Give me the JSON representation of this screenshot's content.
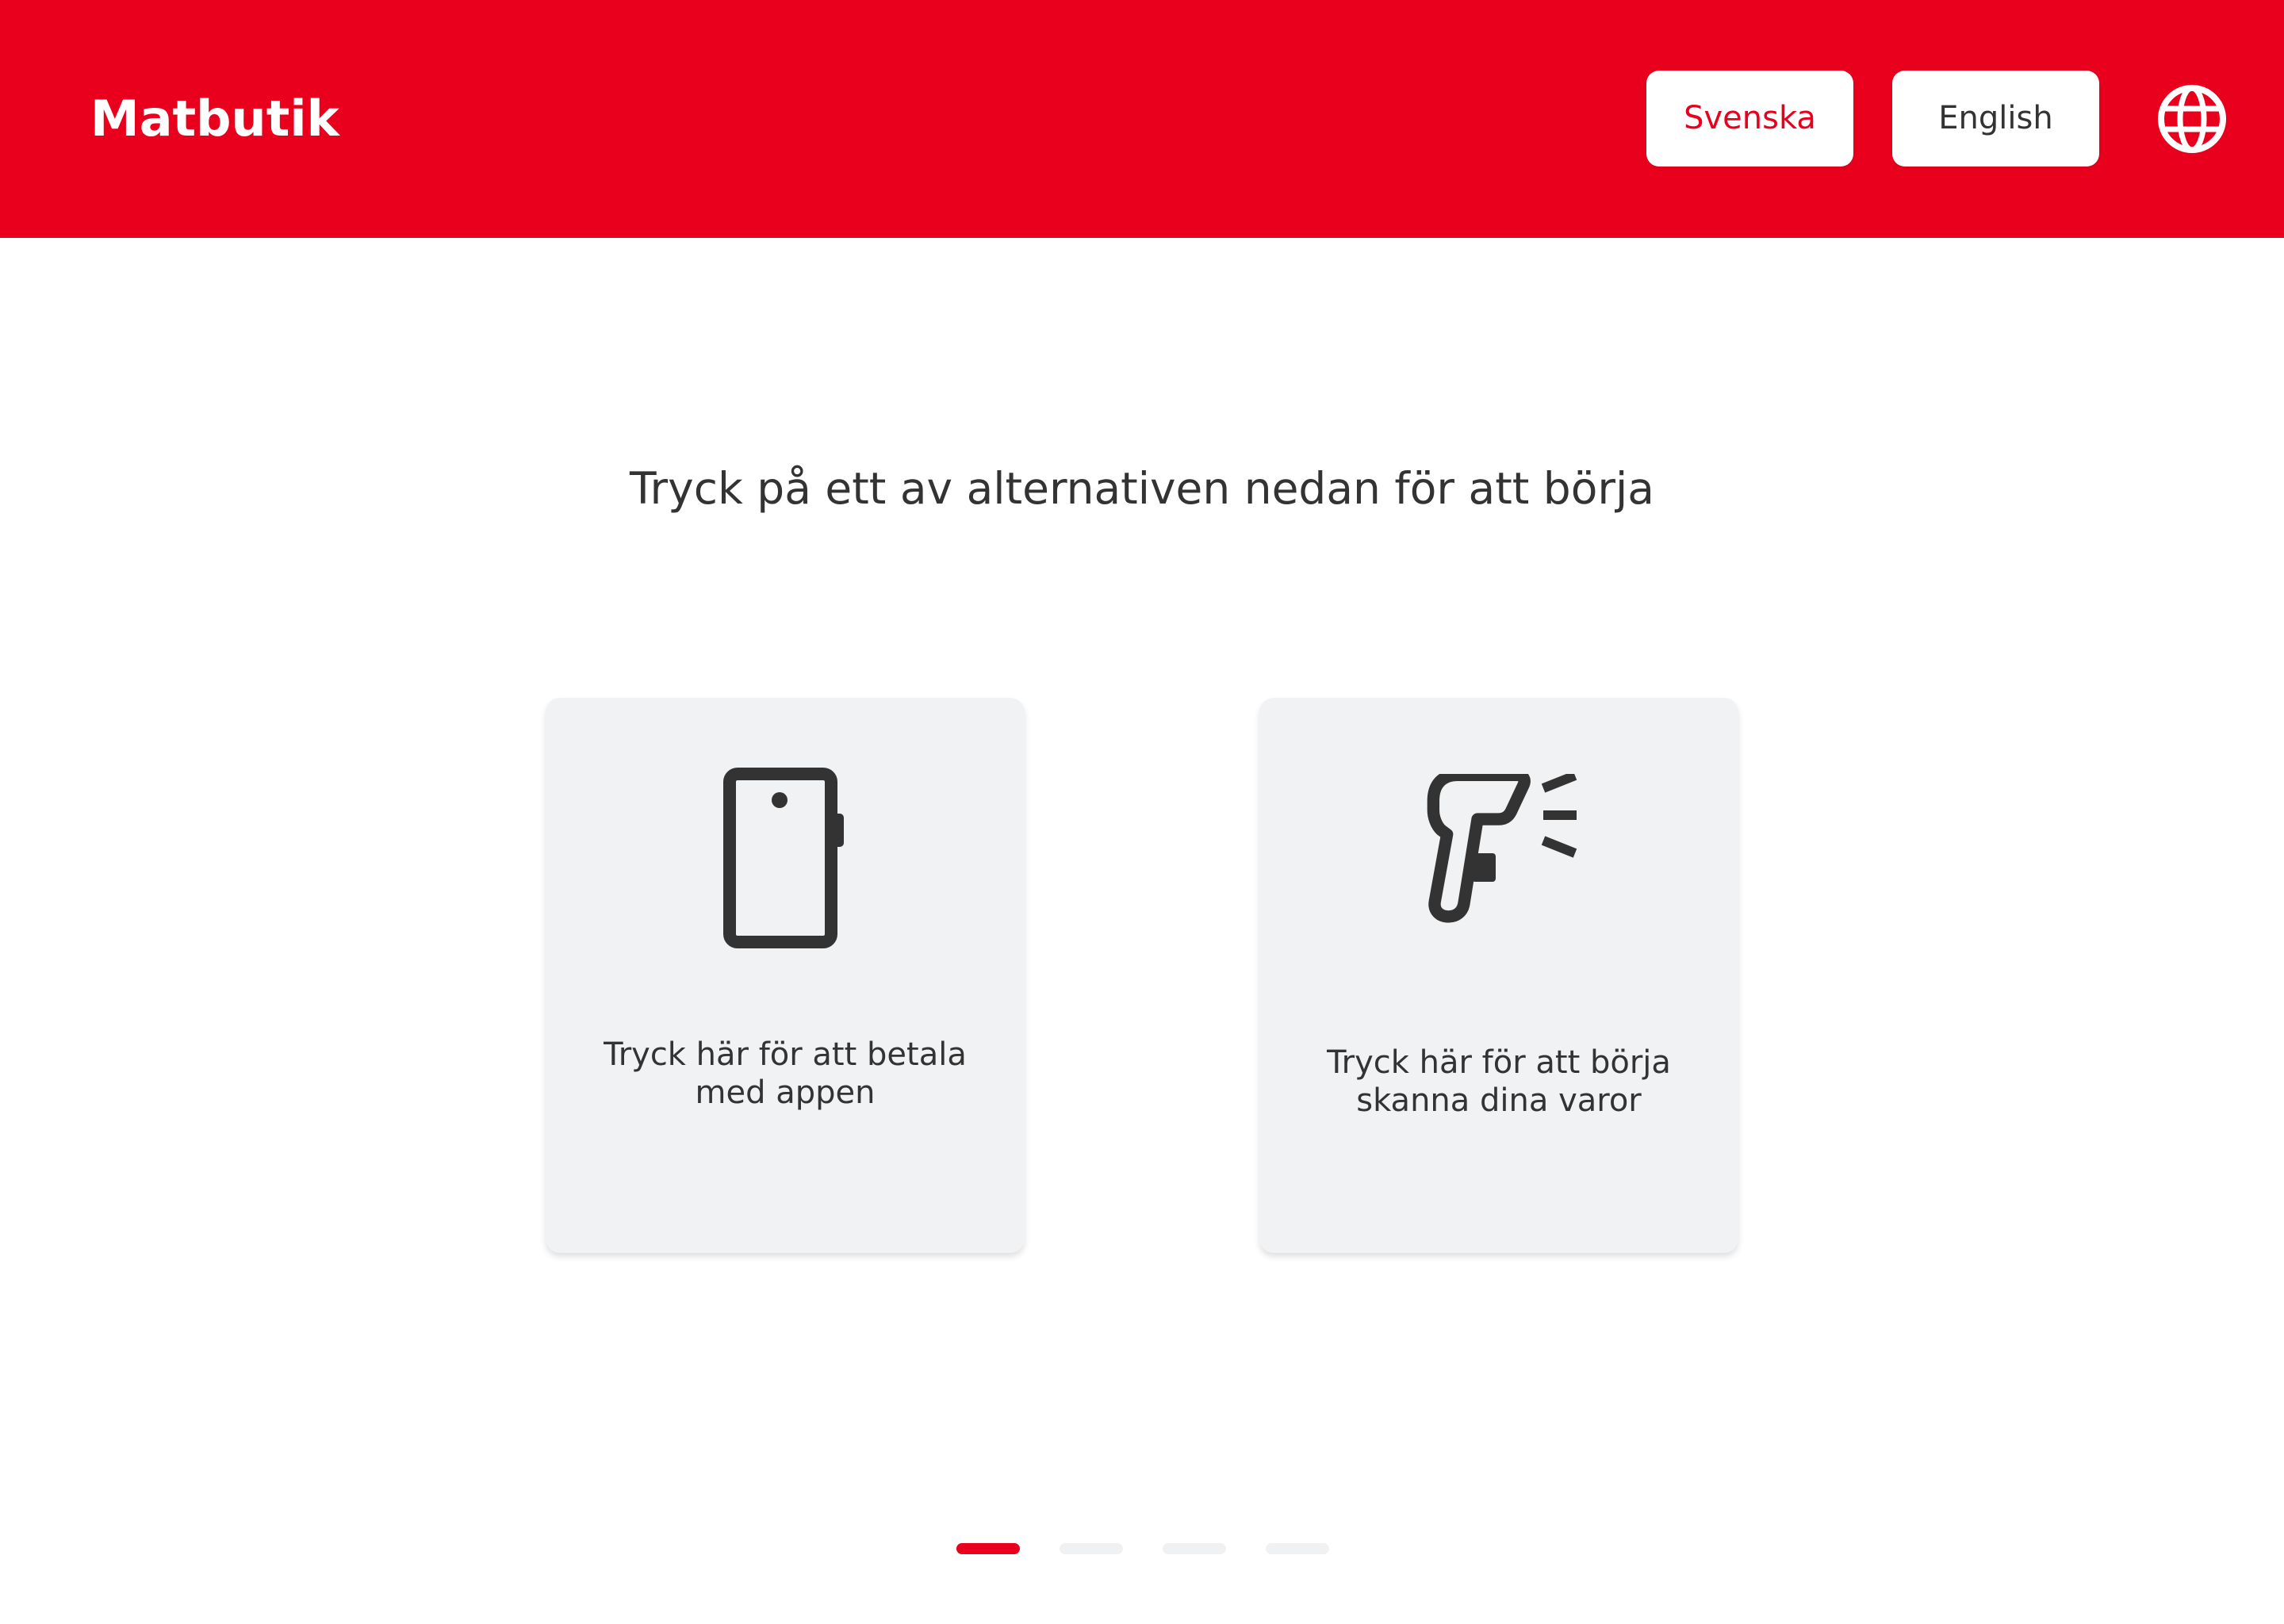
{
  "header": {
    "brand": "Matbutik",
    "languages": [
      {
        "label": "Svenska",
        "selected": true
      },
      {
        "label": "English",
        "selected": false
      }
    ],
    "globe_icon": "globe-icon"
  },
  "main": {
    "prompt": "Tryck på ett av alternativen nedan för att börja",
    "options": [
      {
        "icon": "phone-icon",
        "line1": "Tryck här för att betala",
        "line2": "med appen"
      },
      {
        "icon": "barcode-scanner-icon",
        "line1": "Tryck här för att börja",
        "line2": "skanna dina varor"
      }
    ]
  },
  "pagination": {
    "total": 4,
    "active_index": 0
  },
  "colors": {
    "brand_red": "#E8001C",
    "card_bg": "#F1F2F4",
    "text_dark": "#333333",
    "dot_inactive": "#F0F1F3"
  }
}
